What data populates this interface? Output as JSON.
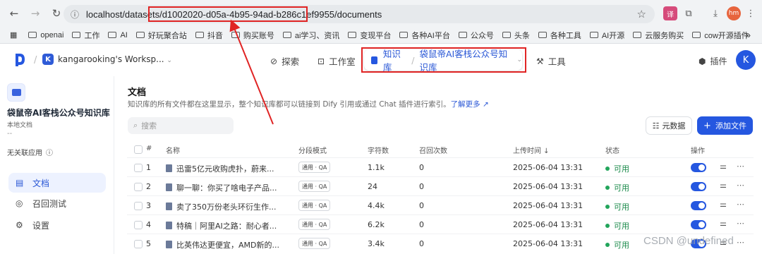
{
  "browser": {
    "url_prefix": "localhost/datasets/",
    "url_highlight": "d1002020-d05a-4b95-94ad-b286c1ef9955",
    "url_suffix": "/documents",
    "profile_initials": "hm",
    "bookmarks": [
      "openai",
      "工作",
      "AI",
      "好玩聚合站",
      "抖音",
      "购买账号",
      "ai学习、资讯",
      "变现平台",
      "各种AI平台",
      "公众号",
      "头条",
      "各种工具",
      "AI开源",
      "云服务购买",
      "cow开源插件"
    ],
    "bookmarks_more": "»"
  },
  "header": {
    "workspace_initial": "K",
    "workspace_name": "kangarooking's Worksp...",
    "nav_explore": "探索",
    "nav_studio": "工作室",
    "nav_knowledge": "知识库",
    "nav_current_kb": "袋鼠帝AI客栈公众号知识库",
    "nav_tools": "工具",
    "plugin": "插件",
    "user_initial": "K"
  },
  "sidebar": {
    "dataset_name": "袋鼠帝AI客栈公众号知识库",
    "dataset_type": "本地文档",
    "dataset_desc": "--",
    "no_app": "无关联应用",
    "items": [
      {
        "label": "文档",
        "icon": "document-icon"
      },
      {
        "label": "召回测试",
        "icon": "target-icon"
      },
      {
        "label": "设置",
        "icon": "settings-icon"
      }
    ]
  },
  "main": {
    "title": "文档",
    "desc": "知识库的所有文件都在这里显示，整个知识库都可以链接到 Dify 引用或通过 Chat 插件进行索引。",
    "learn_more": "了解更多",
    "search_placeholder": "搜索",
    "meta_button": "元数据",
    "add_button": "添加文件",
    "columns": {
      "num": "#",
      "name": "名称",
      "mode": "分段模式",
      "chars": "字符数",
      "recall": "召回次数",
      "uploaded": "上传时间 ↓",
      "status": "状态",
      "actions": "操作"
    },
    "rows": [
      {
        "num": "1",
        "name": "迅雷5亿元收购虎扑，蔚来...",
        "mode": "通用 · QA",
        "chars": "1.1k",
        "recall": "0",
        "uploaded": "2025-06-04 13:31",
        "status": "可用"
      },
      {
        "num": "2",
        "name": "聊一聊：你买了啥电子产品...",
        "mode": "通用 · QA",
        "chars": "24",
        "recall": "0",
        "uploaded": "2025-06-04 13:31",
        "status": "可用"
      },
      {
        "num": "3",
        "name": "卖了350万份老头环衍生作...",
        "mode": "通用 · QA",
        "chars": "4.4k",
        "recall": "0",
        "uploaded": "2025-06-04 13:31",
        "status": "可用"
      },
      {
        "num": "4",
        "name": "特稿｜阿里AI之路：耐心者...",
        "mode": "通用 · QA",
        "chars": "6.2k",
        "recall": "0",
        "uploaded": "2025-06-04 13:31",
        "status": "可用"
      },
      {
        "num": "5",
        "name": "比英伟达更便宜，AMD新的...",
        "mode": "通用 · QA",
        "chars": "3.4k",
        "recall": "0",
        "uploaded": "2025-06-04 13:31",
        "status": "可用"
      }
    ]
  },
  "watermark": "CSDN @undefined"
}
